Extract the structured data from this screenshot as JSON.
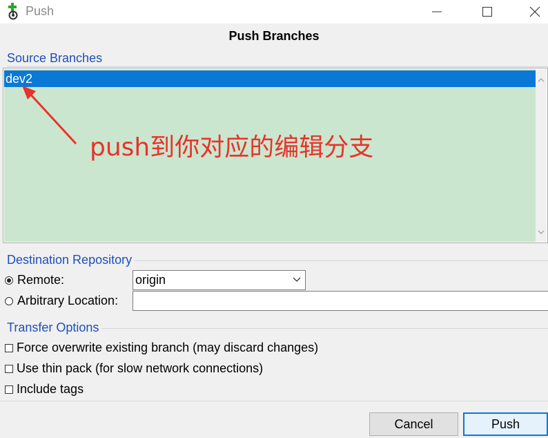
{
  "window": {
    "title": "Push",
    "icons": {
      "app": "git-push-icon",
      "minimize": "minimize-icon",
      "maximize": "maximize-icon",
      "close": "close-icon"
    }
  },
  "dialog": {
    "heading": "Push Branches"
  },
  "source_branches": {
    "label": "Source Branches",
    "items": [
      {
        "label": "dev2",
        "selected": true
      }
    ],
    "list_bg": "#cbe6cf",
    "selection_color": "#0a78d7"
  },
  "annotation": {
    "text": "push到你对应的编辑分支",
    "color": "#e8332a"
  },
  "destination": {
    "label": "Destination Repository",
    "remote_label": "Remote:",
    "remote_selected": true,
    "remote_value": "origin",
    "arbitrary_label": "Arbitrary Location:",
    "arbitrary_value": ""
  },
  "transfer": {
    "label": "Transfer Options",
    "options": [
      {
        "label": "Force overwrite existing branch (may discard changes)",
        "checked": false
      },
      {
        "label": "Use thin pack (for slow network connections)",
        "checked": false
      },
      {
        "label": "Include tags",
        "checked": false
      }
    ]
  },
  "buttons": {
    "cancel": "Cancel",
    "push": "Push"
  }
}
